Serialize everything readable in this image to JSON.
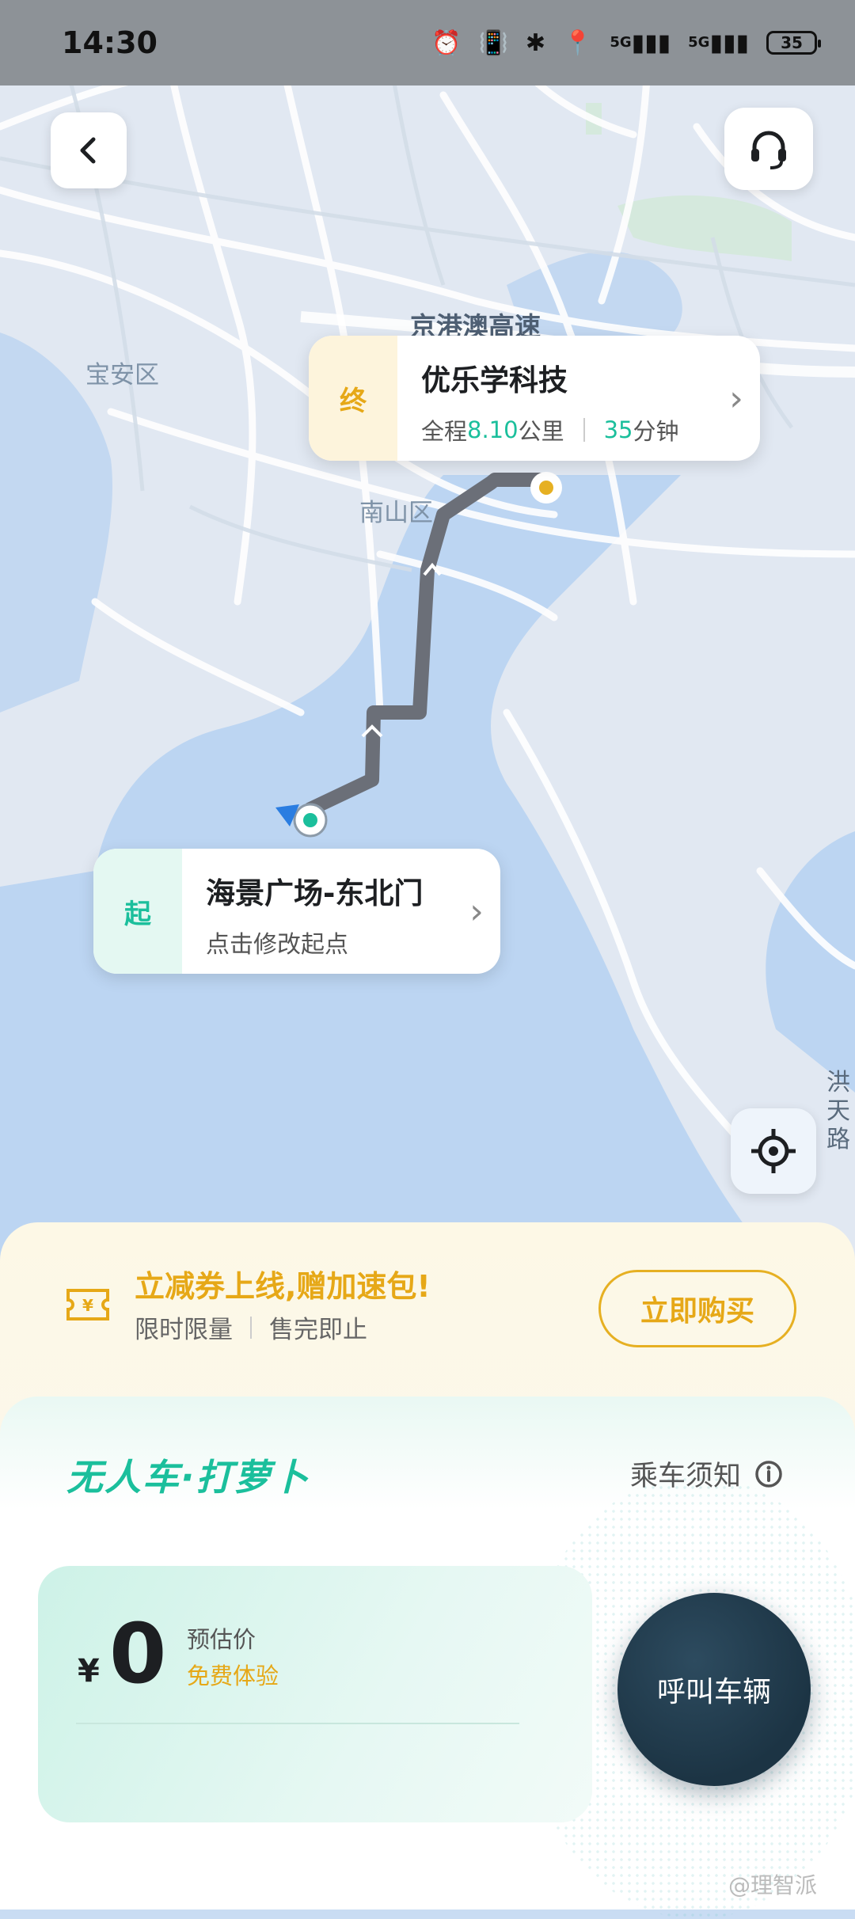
{
  "status_bar": {
    "time": "14:30",
    "network_1": "5G",
    "network_2": "5G",
    "battery": "35"
  },
  "map": {
    "district_1": "宝安区",
    "district_2": "南山区",
    "highway": "京港澳高速",
    "edge_label": "洪\n天\n路"
  },
  "destination": {
    "tag": "终",
    "name": "优乐学科技",
    "distance_prefix": "全程",
    "distance_value": "8.10",
    "distance_unit": "公里",
    "duration_value": "35",
    "duration_unit": "分钟"
  },
  "origin": {
    "tag": "起",
    "name": "海景广场-东北门",
    "hint": "点击修改起点"
  },
  "promo": {
    "title": "立减券上线,赠加速包!",
    "sub_1": "限时限量",
    "sub_2": "售完即止",
    "button": "立即购买"
  },
  "booking": {
    "brand": "无人车·打萝卜",
    "notice": "乘车须知",
    "currency": "¥",
    "price": "0",
    "price_label": "预估价",
    "price_note": "免费体验",
    "call_button": "呼叫车辆"
  },
  "watermark": "@理智派",
  "colors": {
    "accent_teal": "#1bbf9c",
    "accent_yellow": "#e6a817",
    "call_button": "#1c3444",
    "route": "#6b6f78"
  }
}
